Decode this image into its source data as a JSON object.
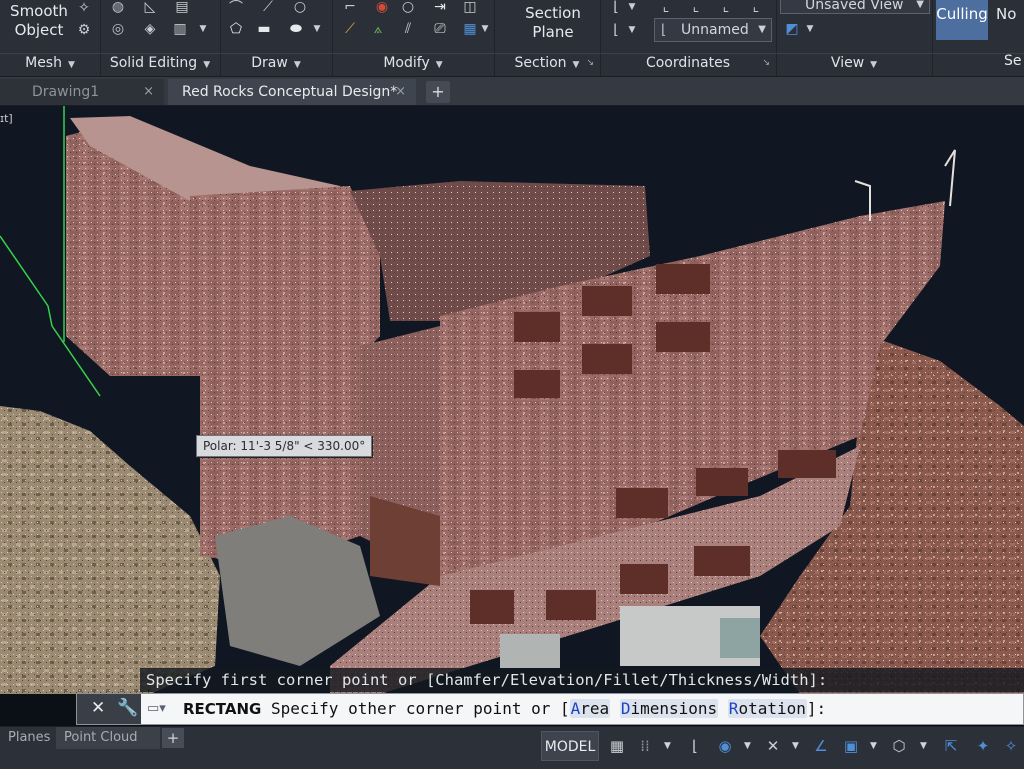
{
  "ribbon": {
    "mesh": {
      "title": "Mesh",
      "smooth_object": "Smooth\nObject"
    },
    "solid_editing": {
      "title": "Solid Editing"
    },
    "draw": {
      "title": "Draw"
    },
    "modify": {
      "title": "Modify"
    },
    "section": {
      "title": "Section",
      "section_plane": "Section\nPlane"
    },
    "coordinates": {
      "title": "Coordinates",
      "ucs_name": "Unnamed"
    },
    "view": {
      "title": "View",
      "named_view": "Unsaved View"
    },
    "culling_label": "Culling",
    "no_label": "No",
    "cut_label": "Se"
  },
  "doc_tabs": [
    {
      "label": "Drawing1",
      "active": false
    },
    {
      "label": "Red Rocks Conceptual Design*",
      "active": true
    }
  ],
  "viewport": {
    "view_label": "ɪt]",
    "polar_tooltip": "Polar: 11'-3 5/8\" < 330.00°"
  },
  "command": {
    "history_line": "Specify first corner point or [Chamfer/Elevation/Fillet/Thickness/Width]:",
    "command_name": "RECTANG",
    "prompt_text": "Specify other corner point or [",
    "options": [
      {
        "key": "A",
        "rest": "rea"
      },
      {
        "key": "D",
        "rest": "imensions"
      },
      {
        "key": "R",
        "rest": "otation"
      }
    ],
    "close_bracket": "]:"
  },
  "status_bar": {
    "layout_tabs": [
      "Planes",
      "Point Cloud"
    ],
    "model_label": "MODEL"
  },
  "colors": {
    "ribbon_bg": "#2b3038",
    "culling_active": "#4d6f9f",
    "option_key": "#1d44c8",
    "viewport_bg": "#101722"
  }
}
